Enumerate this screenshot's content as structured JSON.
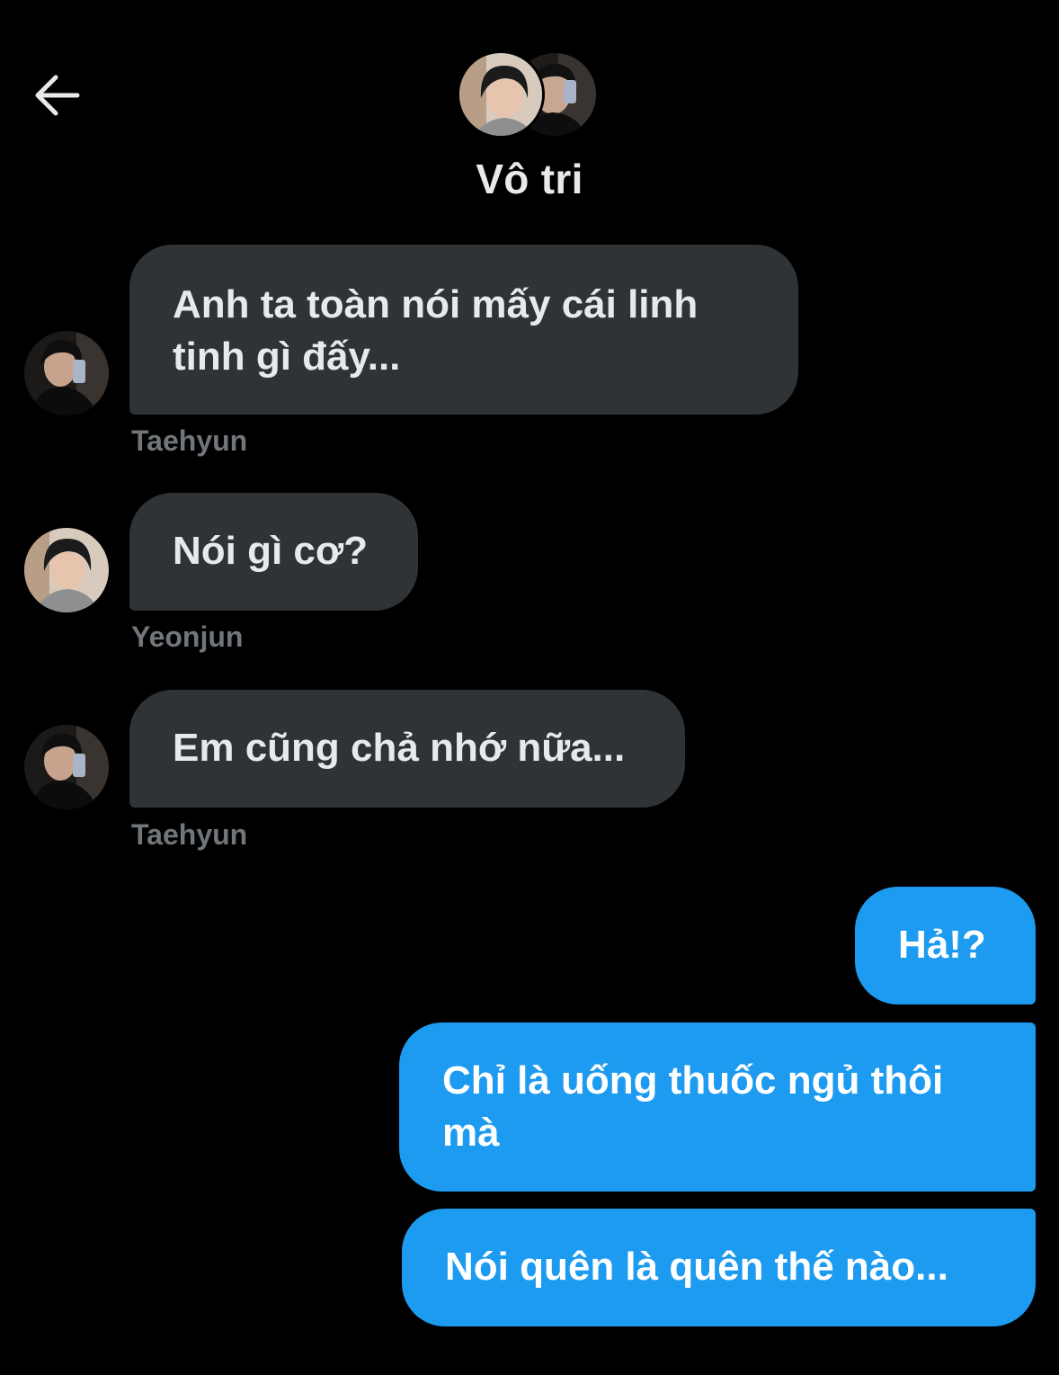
{
  "header": {
    "back_icon": "arrow-left-icon",
    "title": "Vô tri"
  },
  "colors": {
    "background": "#000000",
    "incoming_bubble": "#2f3336",
    "outgoing_bubble": "#1d9bf0",
    "sender_label": "#71767b"
  },
  "messages": [
    {
      "text": "Anh ta toàn nói mấy cái linh tinh gì đấy...",
      "sender": "Taehyun",
      "direction": "incoming"
    },
    {
      "text": "Nói gì cơ?",
      "sender": "Yeonjun",
      "direction": "incoming"
    },
    {
      "text": "Em cũng chả nhớ nữa...",
      "sender": "Taehyun",
      "direction": "incoming"
    },
    {
      "text": "Hả!?",
      "direction": "outgoing"
    },
    {
      "text": "Chỉ là uống thuốc ngủ thôi mà",
      "direction": "outgoing"
    },
    {
      "text": "Nói quên là quên thế nào...",
      "direction": "outgoing"
    }
  ]
}
